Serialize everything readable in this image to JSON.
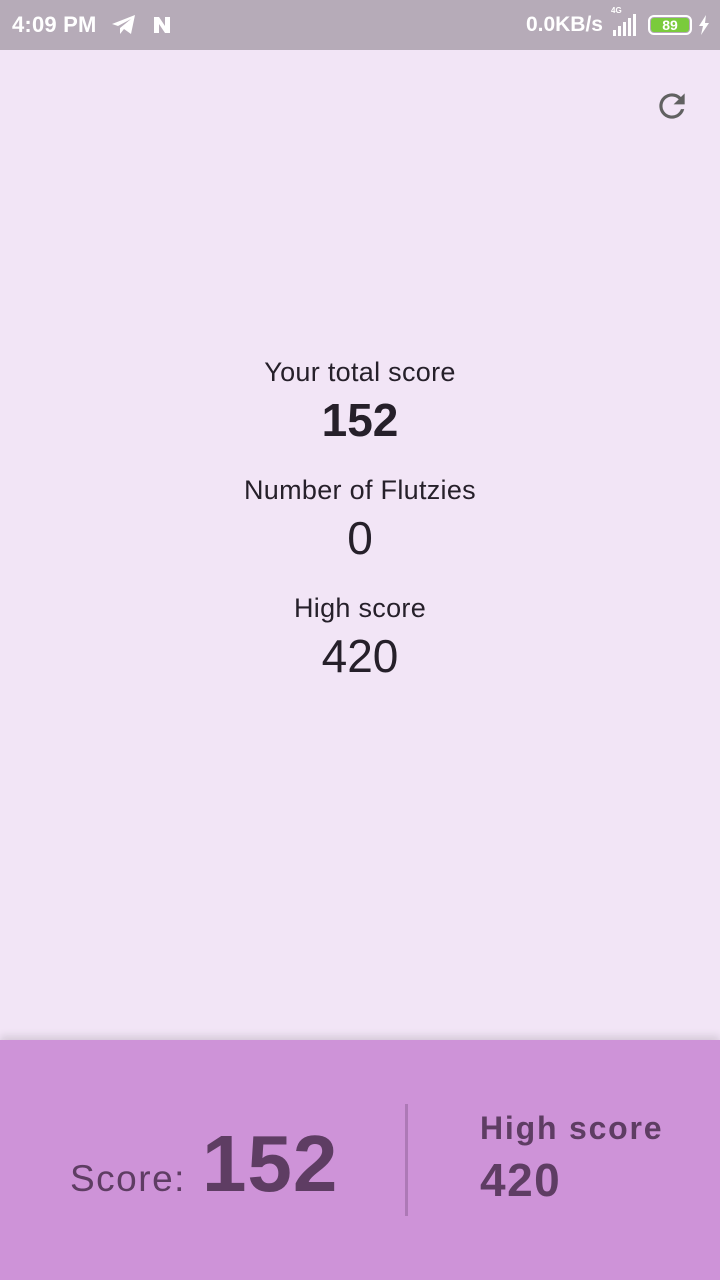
{
  "status_bar": {
    "time": "4:09 PM",
    "icons": [
      "telegram-icon",
      "n-app-icon"
    ],
    "net_speed": "0.0KB/s",
    "network_type": "4G",
    "battery_level": "89",
    "charging": true
  },
  "toolbar": {
    "refresh_icon": "refresh-icon"
  },
  "summary": {
    "total_label": "Your total score",
    "total_value": "152",
    "flutzies_label": "Number of Flutzies",
    "flutzies_value": "0",
    "high_label": "High score",
    "high_value": "420"
  },
  "bottom_panel": {
    "score_label": "Score:",
    "score_value": "152",
    "high_label": "High score",
    "high_value": "420"
  },
  "colors": {
    "background": "#f2e5f6",
    "status_bar": "#b6abb8",
    "panel": "#ce93d8",
    "panel_text": "#5e3d63",
    "battery": "#7acb3c"
  }
}
